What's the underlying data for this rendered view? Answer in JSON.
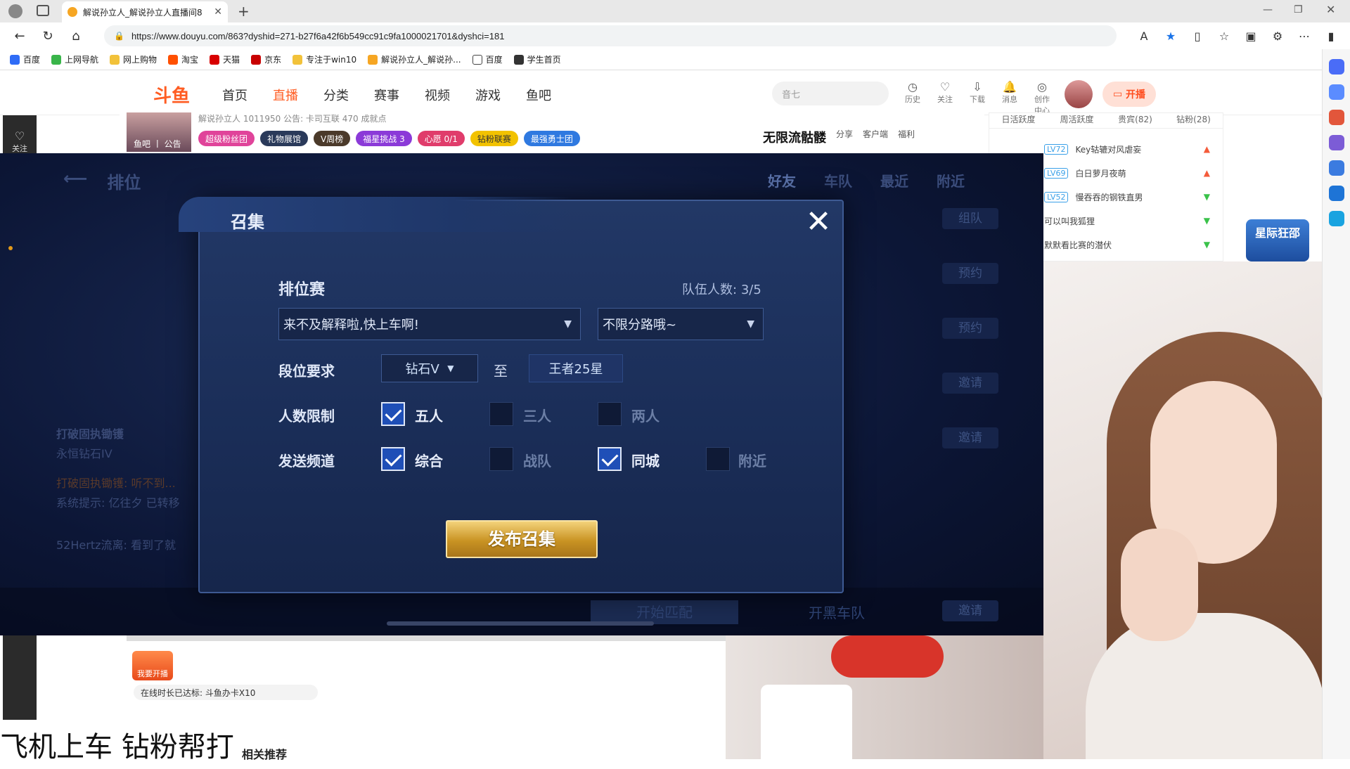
{
  "browser": {
    "tab_title": "解说孙立人_解说孙立人直播间8",
    "url": "https://www.douyu.com/863?dyshid=271-b27f6a42f6b549cc91c9fa1000021701&dyshci=181",
    "bookmarks": [
      "百度",
      "上网导航",
      "网上购物",
      "淘宝",
      "天猫",
      "京东",
      "专注于win10",
      "解说孙立人_解说孙...",
      "百度",
      "学生首页"
    ]
  },
  "douyu_header": {
    "logo": "斗鱼",
    "nav": [
      "首页",
      "直播",
      "分类",
      "赛事",
      "视频",
      "游戏",
      "鱼吧"
    ],
    "search_placeholder": "音七",
    "icons": [
      {
        "label": "历史"
      },
      {
        "label": "关注"
      },
      {
        "label": "下载"
      },
      {
        "label": "消息"
      },
      {
        "label": "创作中心"
      }
    ],
    "live_btn": "开播"
  },
  "room": {
    "thumb_label": "鱼吧 丨 公告",
    "line1": "解说孙立人 1011950   公告: 卡司互联   470 成就点",
    "badges": [
      "超级粉丝团",
      "礼物展馆",
      "V周榜",
      "福星挑战 3",
      "心愿 0/1",
      "钻粉联赛",
      "最强勇士团"
    ],
    "right_title": "无限流骷髅",
    "right_links": [
      "分享",
      "客户端",
      "福利"
    ]
  },
  "sidebar_left": {
    "follow": "关注"
  },
  "rank": {
    "tabs": [
      "日活跃度",
      "周活跃度",
      "贵宾(82)",
      "钻粉(28)"
    ],
    "rows": [
      {
        "lv": "LV72",
        "name": "Key轱辘对风虐妄",
        "up": "up"
      },
      {
        "lv": "LV69",
        "name": "白日萝月夜萌",
        "up": "up"
      },
      {
        "lv": "LV52",
        "name": "慢吞吞的钢铁直男",
        "up": "down"
      },
      {
        "lv": "",
        "name": "可以叫我狐狸",
        "up": "down"
      },
      {
        "lv": "",
        "name": "默默看比赛的潜伏",
        "up": "down"
      }
    ]
  },
  "game": {
    "top_title": "排位",
    "right_tabs": [
      "好友",
      "车队",
      "最近",
      "附近"
    ],
    "side_buttons": [
      "组队",
      "预约",
      "预约",
      "邀请",
      "邀请",
      "邀请"
    ],
    "left_texts": [
      "打破固执锄镬",
      "永恒钻石IV",
      "打破固执锄镬: 听不到...",
      "系统提示: 亿往夕 已转移",
      "52Hertz流离: 看到了就"
    ],
    "bottom_start": "开始匹配",
    "bottom_team": "开黑车队"
  },
  "dialog": {
    "title": "召集",
    "mode": "排位赛",
    "team_count_label": "队伍人数:",
    "team_count": "3/5",
    "slogan": "来不及解释啦,快上车啊!",
    "lane": "不限分路哦~",
    "rank_label": "段位要求",
    "rank_from": "钻石V",
    "rank_to_sep": "至",
    "rank_to": "王者25星",
    "size_label": "人数限制",
    "size_options": [
      {
        "label": "五人",
        "checked": true
      },
      {
        "label": "三人",
        "checked": false
      },
      {
        "label": "两人",
        "checked": false
      }
    ],
    "channel_label": "发送频道",
    "channel_options": [
      {
        "label": "综合",
        "checked": true
      },
      {
        "label": "战队",
        "checked": false
      },
      {
        "label": "同城",
        "checked": true
      },
      {
        "label": "附近",
        "checked": false
      }
    ],
    "publish": "发布召集"
  },
  "stream": {
    "badge": "星际狂邵"
  },
  "below": {
    "kaibo": "我要开播",
    "online_bar": "在线时长已达标: 斗鱼办卡X10",
    "big_text": "飞机上车 钻粉帮打",
    "small_text": "相关推荐"
  }
}
